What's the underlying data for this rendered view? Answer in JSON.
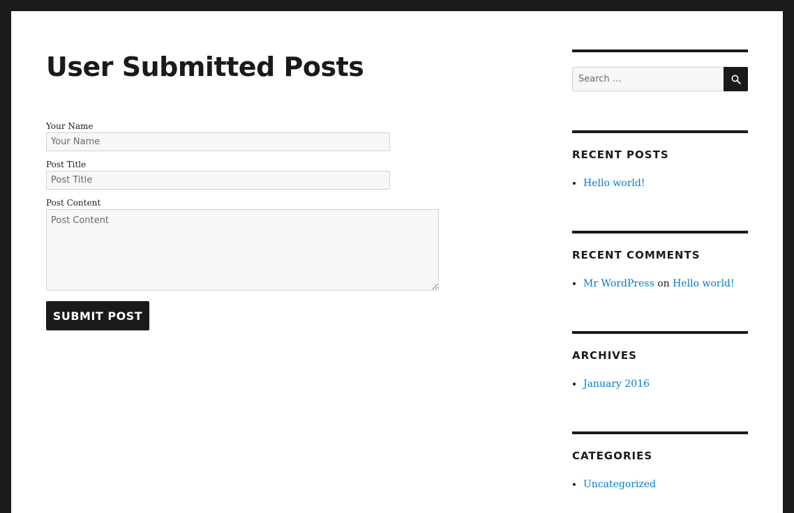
{
  "page": {
    "title": "User Submitted Posts"
  },
  "form": {
    "name_label": "Your Name",
    "name_placeholder": "Your Name",
    "name_value": "",
    "title_label": "Post Title",
    "title_placeholder": "Post Title",
    "title_value": "",
    "content_label": "Post Content",
    "content_placeholder": "Post Content",
    "content_value": "",
    "submit_label": "SUBMIT POST"
  },
  "sidebar": {
    "search": {
      "placeholder": "Search …",
      "value": "",
      "button_icon": "search-icon"
    },
    "recent_posts": {
      "title": "RECENT POSTS",
      "items": [
        {
          "label": "Hello world!"
        }
      ]
    },
    "recent_comments": {
      "title": "RECENT COMMENTS",
      "items": [
        {
          "author": "Mr WordPress",
          "connector": "on",
          "post": "Hello world!"
        }
      ]
    },
    "archives": {
      "title": "ARCHIVES",
      "items": [
        {
          "label": "January 2016"
        }
      ]
    },
    "categories": {
      "title": "CATEGORIES",
      "items": [
        {
          "label": "Uncategorized"
        }
      ]
    }
  },
  "colors": {
    "frame": "#1a1a1a",
    "link": "#007acc",
    "input_bg": "#f7f7f7",
    "button_bg": "#1a1a1a"
  }
}
